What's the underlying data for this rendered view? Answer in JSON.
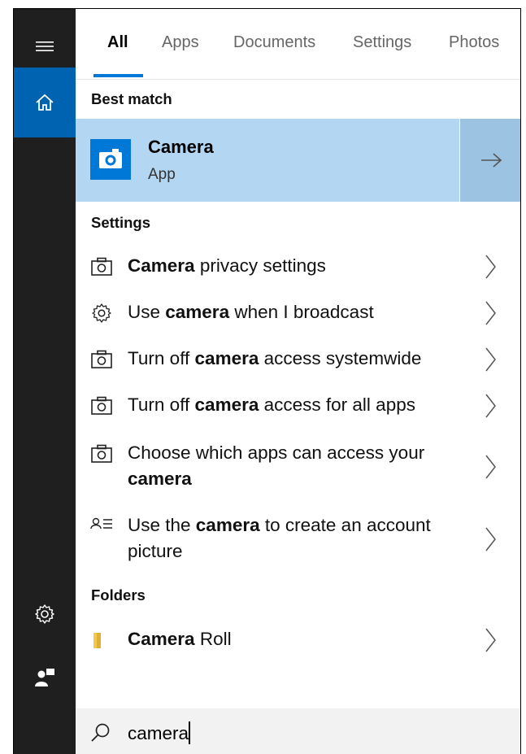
{
  "tabs": [
    {
      "label": "All",
      "active": true
    },
    {
      "label": "Apps",
      "active": false
    },
    {
      "label": "Documents",
      "active": false
    },
    {
      "label": "Settings",
      "active": false
    },
    {
      "label": "Photos",
      "active": false
    }
  ],
  "sections": {
    "best_match": "Best match",
    "settings": "Settings",
    "folders": "Folders"
  },
  "best_match": {
    "title": "Camera",
    "subtitle": "App",
    "icon": "camera-app-icon",
    "accent": "#0078d7",
    "background": "#b3d6f2"
  },
  "settings_results": [
    {
      "icon": "camera-icon",
      "pre": "",
      "bold": "Camera",
      "post": " privacy settings",
      "post2": ""
    },
    {
      "icon": "gear-icon",
      "pre": "Use ",
      "bold": "camera",
      "post": " when I broadcast",
      "post2": ""
    },
    {
      "icon": "camera-icon",
      "pre": "Turn off ",
      "bold": "camera",
      "post": " access systemwide",
      "post2": ""
    },
    {
      "icon": "camera-icon",
      "pre": "Turn off ",
      "bold": "camera",
      "post": " access for all apps",
      "post2": ""
    },
    {
      "icon": "camera-icon",
      "pre": "Choose which apps can access your ",
      "bold": "camera",
      "post": "",
      "post2": ""
    },
    {
      "icon": "account-list-icon",
      "pre": "Use the ",
      "bold": "camera",
      "post": " to create an account picture",
      "post2": ""
    }
  ],
  "folder_results": [
    {
      "icon": "folder-icon",
      "pre": "",
      "bold": "Camera",
      "post": " Roll"
    }
  ],
  "search": {
    "value": "camera",
    "icon": "search-icon"
  },
  "rail": {
    "items": [
      "hamburger-menu-icon",
      "home-icon",
      "settings-gear-icon",
      "feedback-icon"
    ],
    "accent": "#0063b1"
  }
}
